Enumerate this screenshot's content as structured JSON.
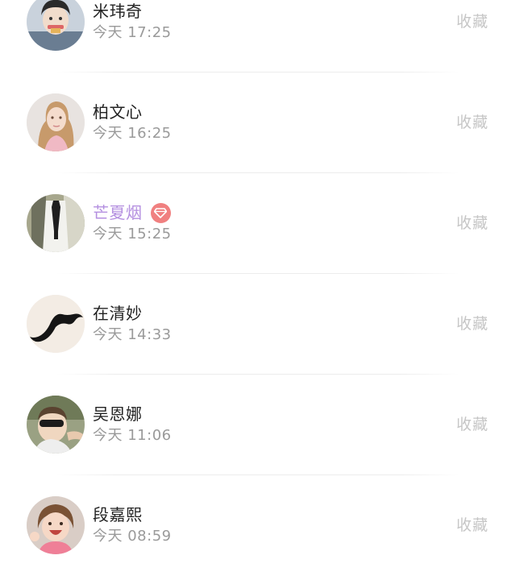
{
  "list": {
    "items": [
      {
        "name": "米玮奇",
        "time": "今天 17:25",
        "action": "收藏",
        "avatar": "boy-avatar",
        "vip": false
      },
      {
        "name": "柏文心",
        "time": "今天 16:25",
        "action": "收藏",
        "avatar": "girl-portrait-avatar",
        "vip": false
      },
      {
        "name": "芒夏烟",
        "time": "今天 15:25",
        "action": "收藏",
        "avatar": "tie-shirt-avatar",
        "vip": true
      },
      {
        "name": "在清妙",
        "time": "今天 14:33",
        "action": "收藏",
        "avatar": "mustache-avatar",
        "vip": false
      },
      {
        "name": "吴恩娜",
        "time": "今天 11:06",
        "action": "收藏",
        "avatar": "sunglasses-kid-avatar",
        "vip": false
      },
      {
        "name": "段嘉熙",
        "time": "今天 08:59",
        "action": "收藏",
        "avatar": "laughing-girl-avatar",
        "vip": false
      }
    ]
  },
  "colors": {
    "name": "#222222",
    "vip_name": "#b48fe0",
    "vip_badge": "#f08080",
    "time": "#9a9a9a",
    "action": "#c6c6c6"
  },
  "icons": {
    "vip_badge": "diamond-icon"
  }
}
